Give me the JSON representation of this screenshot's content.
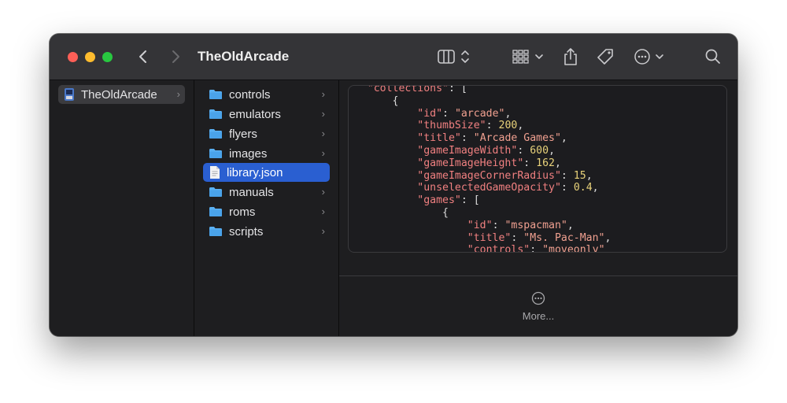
{
  "window": {
    "title": "TheOldArcade"
  },
  "toolbar": {
    "icons": [
      "back-icon",
      "forward-icon",
      "view-columns-icon",
      "group-icon",
      "share-icon",
      "tag-icon",
      "more-actions-icon",
      "search-icon"
    ]
  },
  "sidebar": {
    "items": [
      {
        "label": "TheOldArcade",
        "icon": "app-icon",
        "selected": true
      }
    ]
  },
  "column": {
    "items": [
      {
        "label": "controls",
        "type": "folder"
      },
      {
        "label": "emulators",
        "type": "folder"
      },
      {
        "label": "flyers",
        "type": "folder"
      },
      {
        "label": "images",
        "type": "folder"
      },
      {
        "label": "library.json",
        "type": "file",
        "selected": true
      },
      {
        "label": "manuals",
        "type": "folder"
      },
      {
        "label": "roms",
        "type": "folder"
      },
      {
        "label": "scripts",
        "type": "folder"
      }
    ]
  },
  "preview": {
    "code_lines": [
      "    \"collections\": [",
      "        {",
      "            \"id\": \"arcade\",",
      "            \"thumbSize\": 200,",
      "            \"title\": \"Arcade Games\",",
      "            \"gameImageWidth\": 600,",
      "            \"gameImageHeight\": 162,",
      "            \"gameImageCornerRadius\": 15,",
      "            \"unselectedGameOpacity\": 0.4,",
      "            \"games\": [",
      "                {",
      "                    \"id\": \"mspacman\",",
      "                    \"title\": \"Ms. Pac-Man\",",
      "                    \"controls\": \"moveonly\""
    ],
    "more_label": "More..."
  },
  "colors": {
    "selection_blue": "#2a5fd1",
    "folder_blue": "#5ab0f2",
    "json_key": "#f08080",
    "json_number": "#e8d27a"
  }
}
